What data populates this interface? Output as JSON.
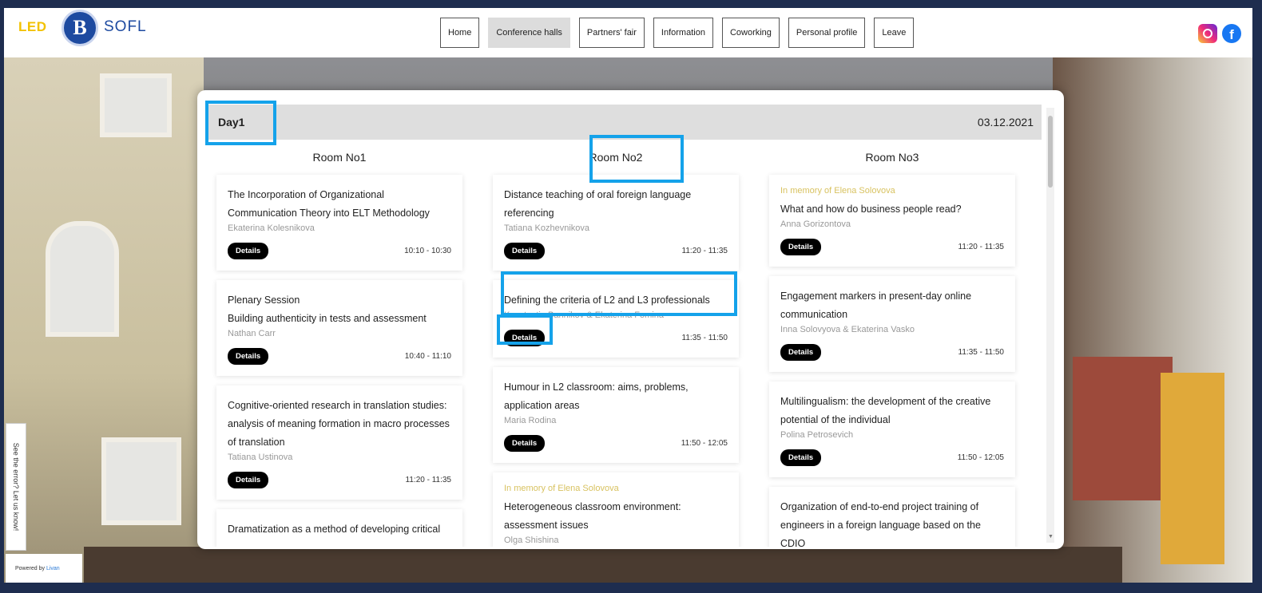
{
  "header": {
    "logo_led": "LED",
    "logo_emblem": "B",
    "logo_sofl": "SOFL",
    "nav": [
      {
        "label": "Home",
        "active": false
      },
      {
        "label": "Conference halls",
        "active": true
      },
      {
        "label": "Partners' fair",
        "active": false
      },
      {
        "label": "Information",
        "active": false
      },
      {
        "label": "Coworking",
        "active": false
      },
      {
        "label": "Personal profile",
        "active": false
      },
      {
        "label": "Leave",
        "active": false
      }
    ],
    "social": {
      "instagram_icon": "instagram-icon",
      "facebook_icon": "facebook-icon",
      "facebook_glyph": "f"
    }
  },
  "sidebar": {
    "feedback_label": "See the error? Let us know!",
    "powered_label": "Powered by",
    "powered_brand": "Livan"
  },
  "schedule": {
    "day_label": "Day1",
    "date": "03.12.2021",
    "rooms": [
      {
        "name": "Room No1",
        "sessions": [
          {
            "note": "",
            "title": "The Incorporation of Organizational Communication Theory into ELT Methodology",
            "author": "Ekaterina Kolesnikova",
            "button": "Details",
            "time": "10:10 - 10:30"
          },
          {
            "note": "",
            "title": "Plenary Session",
            "subtitle": "Building authenticity in tests and assessment",
            "author": "Nathan Carr",
            "button": "Details",
            "time": "10:40 - 11:10"
          },
          {
            "note": "",
            "title": "Cognitive-oriented research in translation studies: analysis of meaning formation in macro processes of translation",
            "author": "Tatiana Ustinova",
            "button": "Details",
            "time": "11:20 - 11:35"
          },
          {
            "note": "",
            "title": "Dramatization as a method of developing critical",
            "author": "",
            "button": "",
            "time": ""
          }
        ]
      },
      {
        "name": "Room No2",
        "sessions": [
          {
            "note": "",
            "title": "Distance teaching of oral foreign language referencing",
            "author": "Tatiana Kozhevnikova",
            "button": "Details",
            "time": "11:20 - 11:35"
          },
          {
            "note": "",
            "title": "Defining the criteria of L2 and L3 professionals",
            "author": "Konstantin Bannikov & Ekaterina Fomina",
            "button": "Details",
            "time": "11:35 - 11:50"
          },
          {
            "note": "",
            "title": "Humour in L2 classroom: aims, problems, application areas",
            "author": "Maria Rodina",
            "button": "Details",
            "time": "11:50 - 12:05"
          },
          {
            "note": "In memory of Elena Solovova",
            "title": "Heterogeneous classroom environment: assessment issues",
            "author": "Olga Shishina",
            "button": "",
            "time": ""
          }
        ]
      },
      {
        "name": "Room No3",
        "sessions": [
          {
            "note": "In memory of Elena Solovova",
            "title": "What and how do business people read?",
            "author": "Anna Gorizontova",
            "button": "Details",
            "time": "11:20 - 11:35"
          },
          {
            "note": "",
            "title": "Engagement markers in present-day online communication",
            "author": "Inna Solovyova & Ekaterina Vasko",
            "button": "Details",
            "time": "11:35 - 11:50"
          },
          {
            "note": "",
            "title": "Multilingualism: the development of the creative potential of the individual",
            "author": "Polina Petrosevich",
            "button": "Details",
            "time": "11:50 - 12:05"
          },
          {
            "note": "",
            "title": "Organization of end-to-end project training of engineers in a foreign language based on the CDIO",
            "author": "",
            "button": "",
            "time": ""
          }
        ]
      }
    ]
  },
  "colors": {
    "frame_bg": "#1e2d4f",
    "highlight": "#14a2ea",
    "memory_note": "#d8c260",
    "logo_led": "#f2c200",
    "logo_emblem": "#1d4aa0"
  }
}
